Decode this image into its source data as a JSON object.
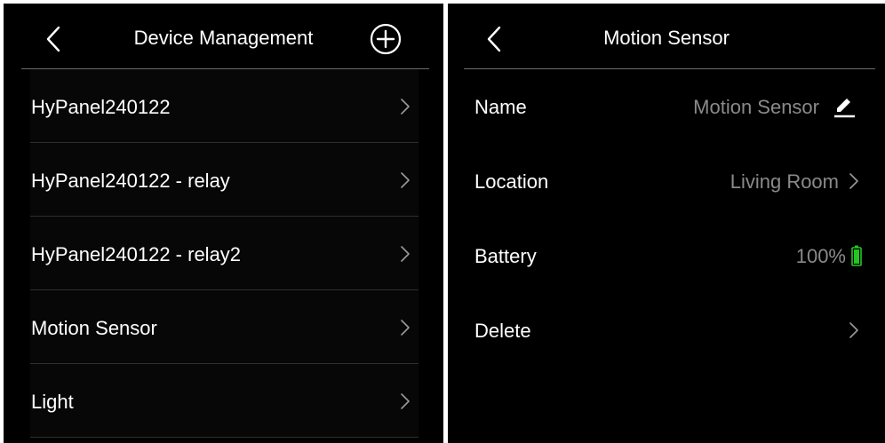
{
  "device_management": {
    "title": "Device Management",
    "items": [
      {
        "label": "HyPanel240122"
      },
      {
        "label": "HyPanel240122 - relay"
      },
      {
        "label": "HyPanel240122 - relay2"
      },
      {
        "label": "Motion Sensor"
      },
      {
        "label": "Light"
      }
    ]
  },
  "device_detail": {
    "title": "Motion Sensor",
    "rows": {
      "name": {
        "label": "Name",
        "value": "Motion Sensor"
      },
      "location": {
        "label": "Location",
        "value": "Living Room"
      },
      "battery": {
        "label": "Battery",
        "value": "100%",
        "level": 1.0
      },
      "delete": {
        "label": "Delete"
      }
    }
  },
  "icons": {
    "back": "chevron-left-icon",
    "add": "plus-circle-icon",
    "row_arrow": "chevron-right-icon",
    "edit": "pencil-icon",
    "battery": "battery-full-icon"
  },
  "colors": {
    "background": "#000000",
    "text": "#ffffff",
    "secondary_text": "#8a8a8a",
    "divider": "#6a6a6a",
    "battery": "#22c522"
  }
}
